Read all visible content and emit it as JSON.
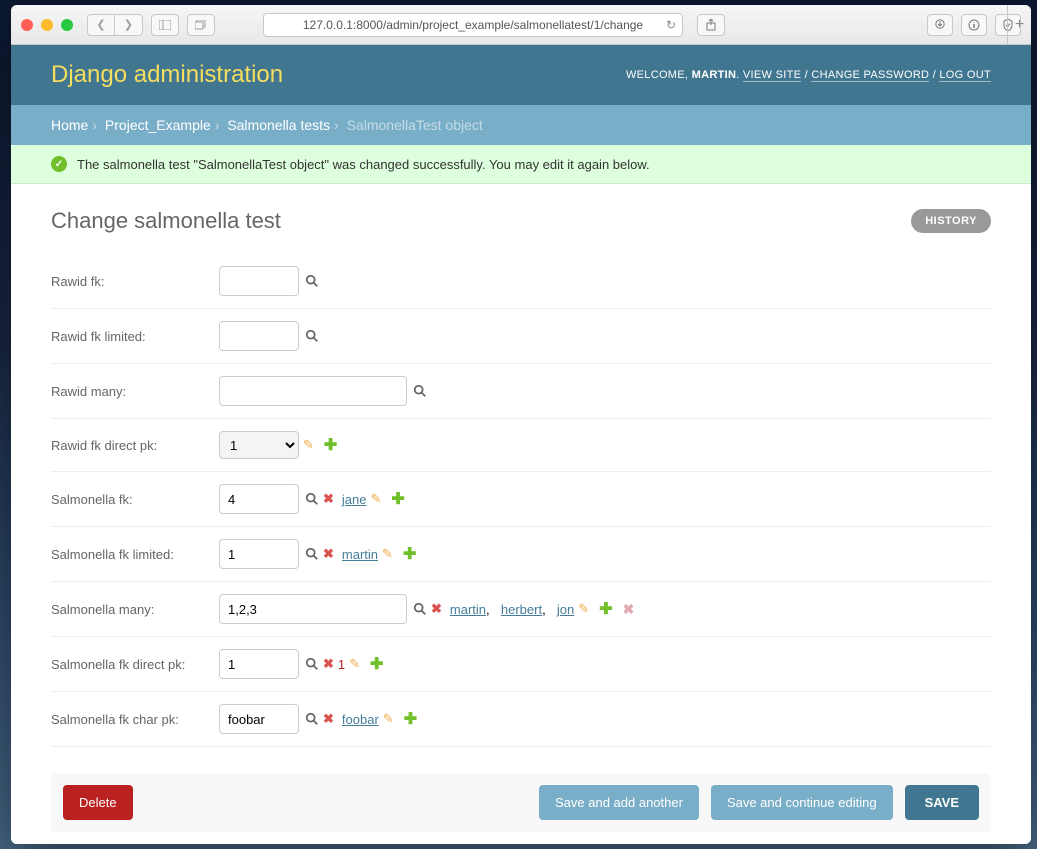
{
  "browser": {
    "url": "127.0.0.1:8000/admin/project_example/salmonellatest/1/change"
  },
  "header": {
    "site_title": "Django administration",
    "welcome": "WELCOME, ",
    "username": "MARTIN",
    "view_site": "VIEW SITE",
    "change_password": "CHANGE PASSWORD",
    "logout": "LOG OUT"
  },
  "breadcrumbs": {
    "home": "Home",
    "app": "Project_Example",
    "model": "Salmonella tests",
    "object": "SalmonellaTest object"
  },
  "message": {
    "text": "The salmonella test \"SalmonellaTest object\" was changed successfully. You may edit it again below."
  },
  "page_title": "Change salmonella test",
  "history_label": "HISTORY",
  "fields": {
    "rawid_fk": {
      "label": "Rawid fk:",
      "value": ""
    },
    "rawid_fk_limited": {
      "label": "Rawid fk limited:",
      "value": ""
    },
    "rawid_many": {
      "label": "Rawid many:",
      "value": ""
    },
    "rawid_fk_direct_pk": {
      "label": "Rawid fk direct pk:",
      "selected": "1"
    },
    "salmonella_fk": {
      "label": "Salmonella fk:",
      "value": "4",
      "linked": "jane"
    },
    "salmonella_fk_limited": {
      "label": "Salmonella fk limited:",
      "value": "1",
      "linked": "martin"
    },
    "salmonella_many": {
      "label": "Salmonella many:",
      "value": "1,2,3",
      "linked_list": [
        "martin",
        "herbert",
        "jon"
      ]
    },
    "salmonella_fk_direct_pk": {
      "label": "Salmonella fk direct pk:",
      "value": "1",
      "linked_pk": "1"
    },
    "salmonella_fk_char_pk": {
      "label": "Salmonella fk char pk:",
      "value": "foobar",
      "linked": "foobar"
    }
  },
  "buttons": {
    "delete": "Delete",
    "save_add": "Save and add another",
    "save_continue": "Save and continue editing",
    "save": "SAVE"
  }
}
